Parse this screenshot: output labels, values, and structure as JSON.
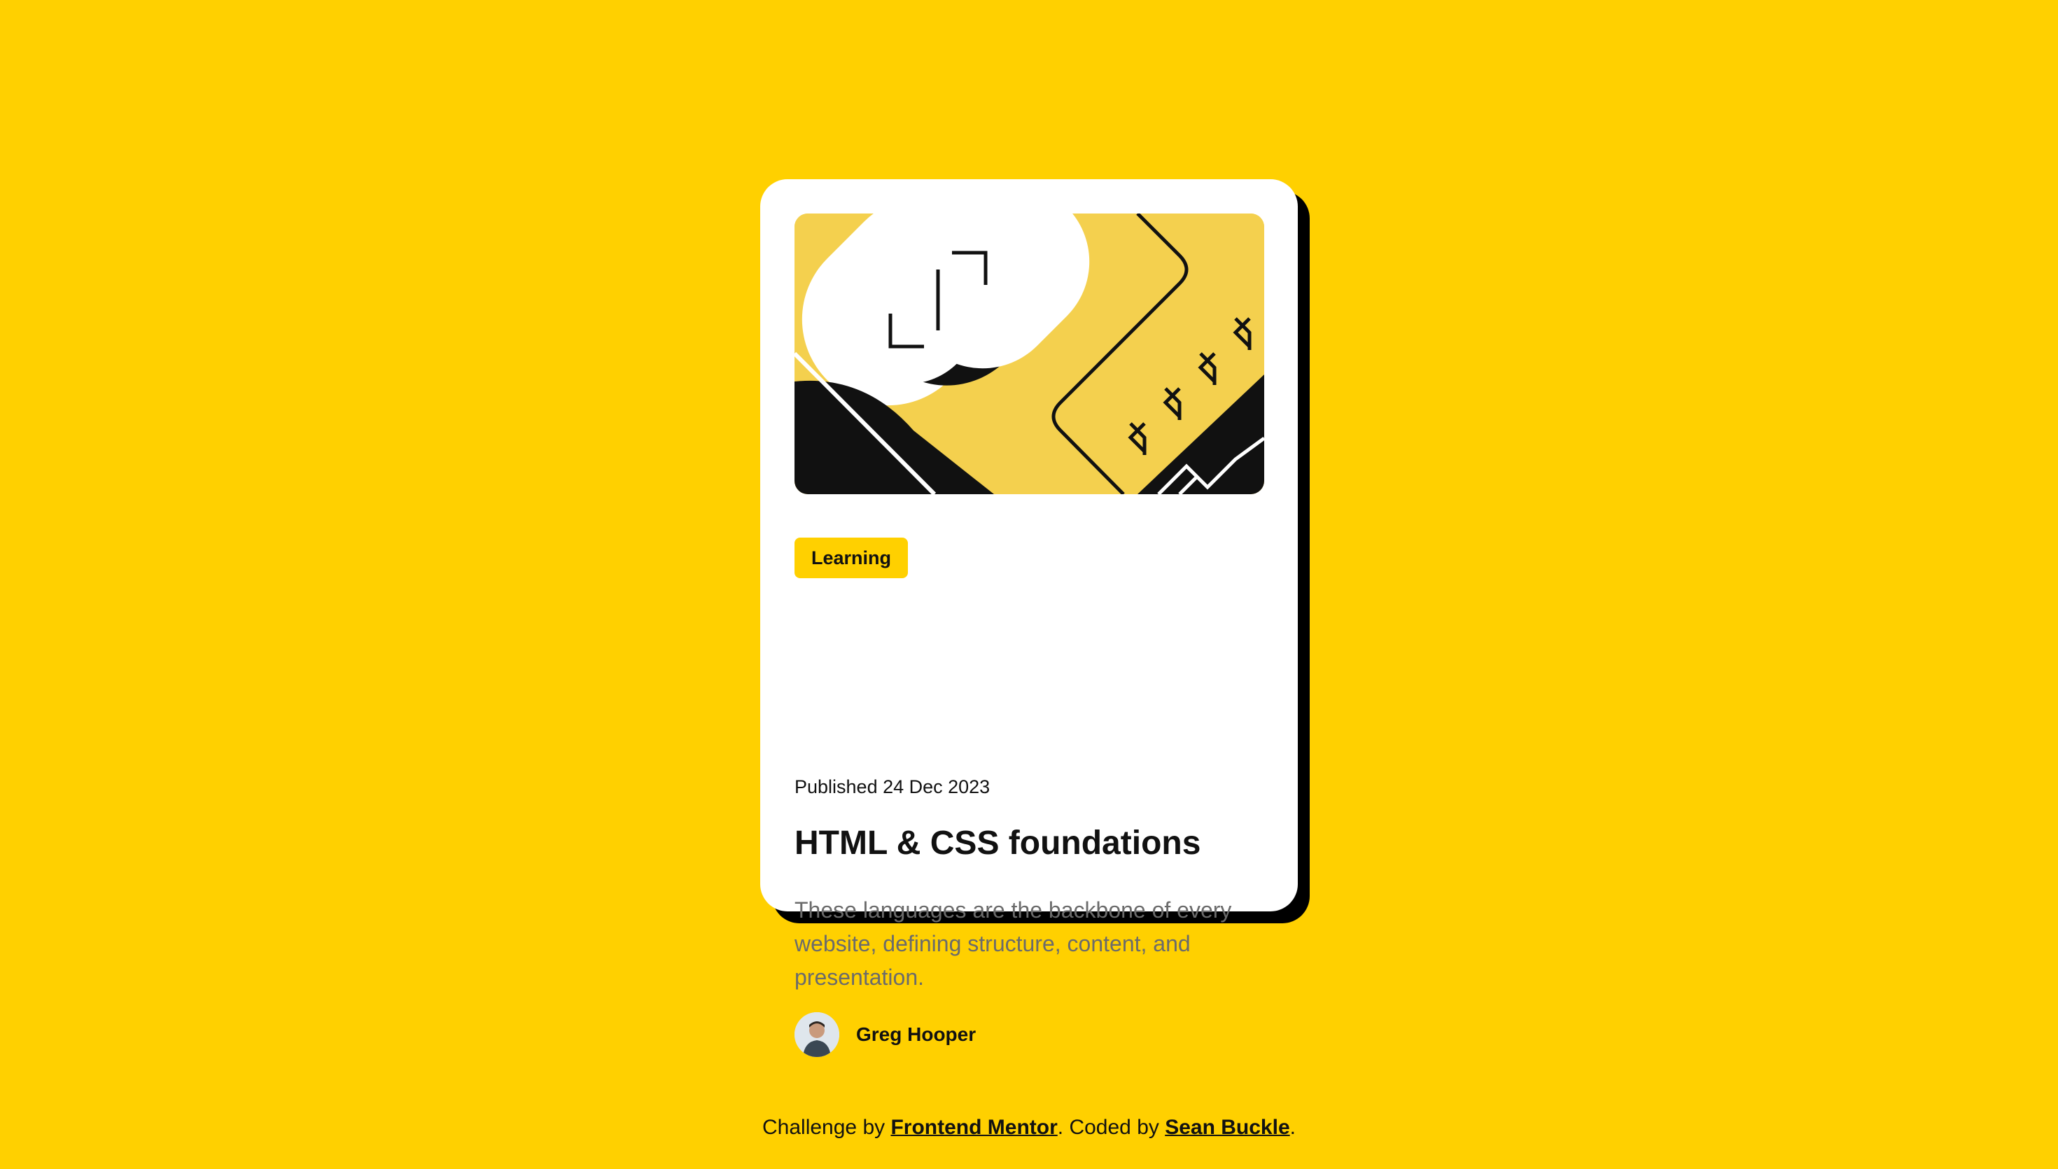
{
  "card": {
    "tag": "Learning",
    "published": "Published 24 Dec 2023",
    "title": "HTML & CSS foundations",
    "description": "These languages are the backbone of every website, defining structure, content, and presentation.",
    "author_name": "Greg Hooper"
  },
  "footer": {
    "prefix": "Challenge by",
    "frontend_mentor_link": "Frontend Mentor",
    "middle": ". Coded by",
    "author_link": "Sean Buckle",
    "suffix": "."
  },
  "colors": {
    "page_background": "#FFD000",
    "card_background": "#FFFFFF",
    "shadow": "#000000",
    "tag_background": "#FFD000",
    "hero_background": "#F4D04E",
    "text_dark": "#111111",
    "text_muted": "#6B6B6B"
  },
  "icons": {
    "hero": "abstract-illustration",
    "avatar": "user-avatar"
  }
}
